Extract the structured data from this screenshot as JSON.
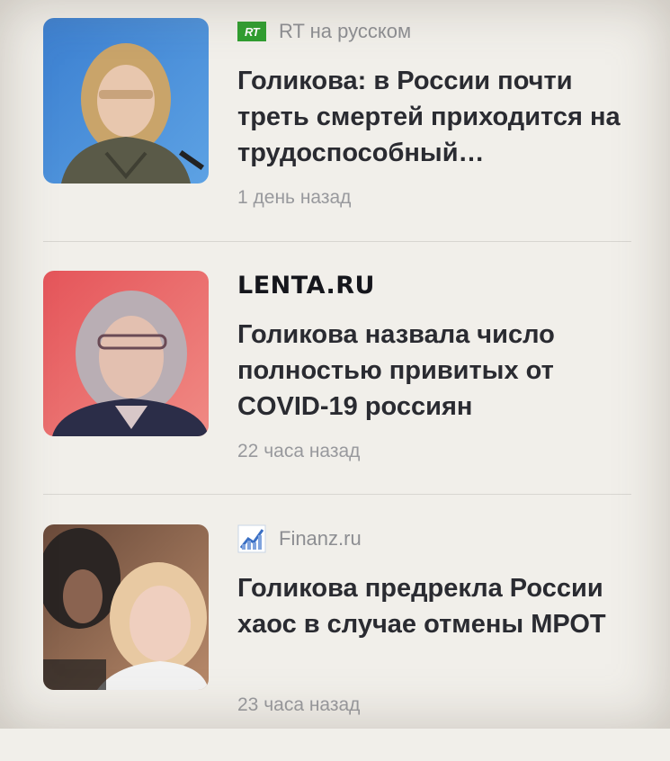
{
  "news": [
    {
      "source": "RT на русском",
      "source_icon": "rt-logo-icon",
      "rt_logo_text": "RT",
      "headline": "Голикова: в России почти треть смертей приходится на трудоспособный…",
      "time": "1 день назад"
    },
    {
      "source": "LENTA.RU",
      "source_icon": "lenta-logo",
      "headline": "Голикова назвала число полностью привитых от COVID-19 россиян",
      "time": "22 часа назад"
    },
    {
      "source": "Finanz.ru",
      "source_icon": "finanz-chart-icon",
      "headline": "Голикова предрекла России хаос в случае отмены МРОТ",
      "time": "23 часа назад"
    }
  ],
  "colors": {
    "background": "#f1efea",
    "headline": "#2a2b31",
    "meta": "#8d8e92",
    "rt_green": "#2f9e2f"
  }
}
